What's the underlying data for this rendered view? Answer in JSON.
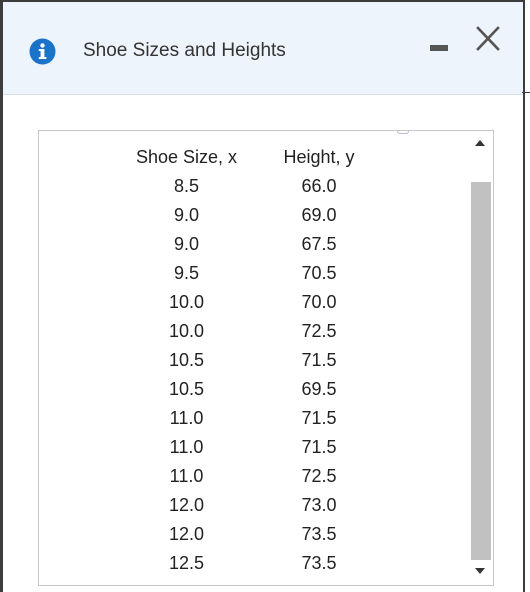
{
  "dialog": {
    "title": "Shoe Sizes and Heights",
    "icon": "info-icon",
    "accent_color": "#1a73c8"
  },
  "controls": {
    "minimize_icon": "minimize-icon",
    "close_icon": "close-icon"
  },
  "table": {
    "headers": [
      "Shoe Size, x",
      "Height, y"
    ],
    "rows": [
      [
        "8.5",
        "66.0"
      ],
      [
        "9.0",
        "69.0"
      ],
      [
        "9.0",
        "67.5"
      ],
      [
        "9.5",
        "70.5"
      ],
      [
        "10.0",
        "70.0"
      ],
      [
        "10.0",
        "72.5"
      ],
      [
        "10.5",
        "71.5"
      ],
      [
        "10.5",
        "69.5"
      ],
      [
        "11.0",
        "71.5"
      ],
      [
        "11.0",
        "71.5"
      ],
      [
        "11.0",
        "72.5"
      ],
      [
        "12.0",
        "73.0"
      ],
      [
        "12.0",
        "73.5"
      ],
      [
        "12.5",
        "73.5"
      ]
    ]
  }
}
